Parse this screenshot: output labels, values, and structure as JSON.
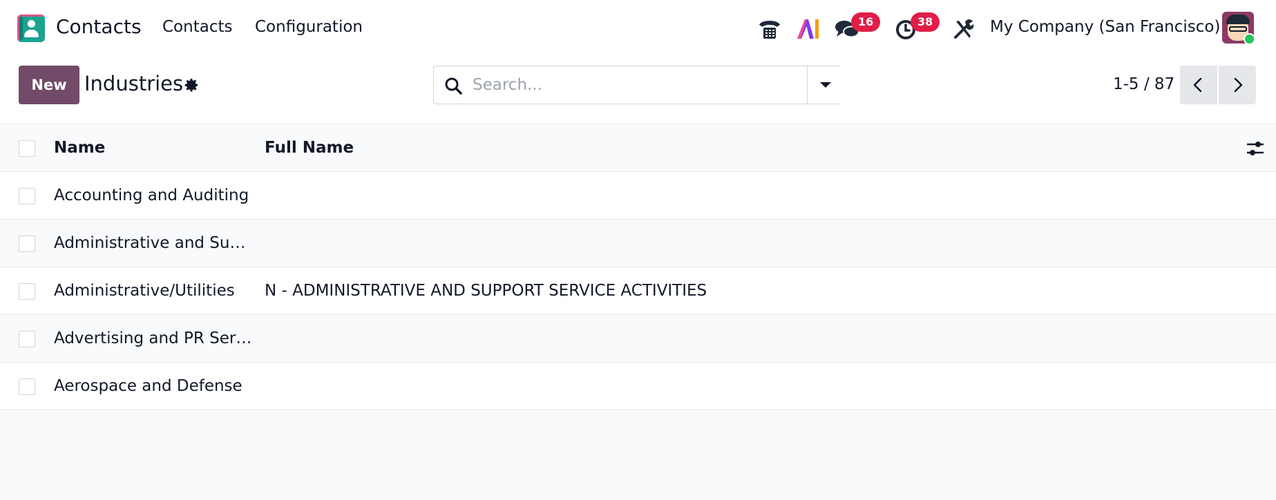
{
  "navbar": {
    "brand": "Contacts",
    "menu": [
      {
        "label": "Contacts"
      },
      {
        "label": "Configuration"
      }
    ],
    "badges": {
      "messages": "16",
      "activities": "38"
    },
    "company": "My Company (San Francisco)",
    "icons": [
      "phone-icon",
      "ai-icon",
      "chat-icon",
      "clock-icon",
      "tools-icon"
    ]
  },
  "control_panel": {
    "new_label": "New",
    "title": "Industries",
    "search_placeholder": "Search...",
    "pager": "1-5 / 87"
  },
  "table": {
    "columns": [
      "Name",
      "Full Name"
    ],
    "rows": [
      {
        "name": "Accounting and Auditing",
        "full_name": ""
      },
      {
        "name": "Administrative and Support",
        "full_name": ""
      },
      {
        "name": "Administrative/Utilities",
        "full_name": "N - ADMINISTRATIVE AND SUPPORT SERVICE ACTIVITIES"
      },
      {
        "name": "Advertising and PR Services",
        "full_name": ""
      },
      {
        "name": "Aerospace and Defense",
        "full_name": ""
      }
    ]
  },
  "colors": {
    "primary": "#714b67",
    "badge": "#e11d48",
    "app_icon": "#1aa390",
    "online": "#22c55e"
  }
}
